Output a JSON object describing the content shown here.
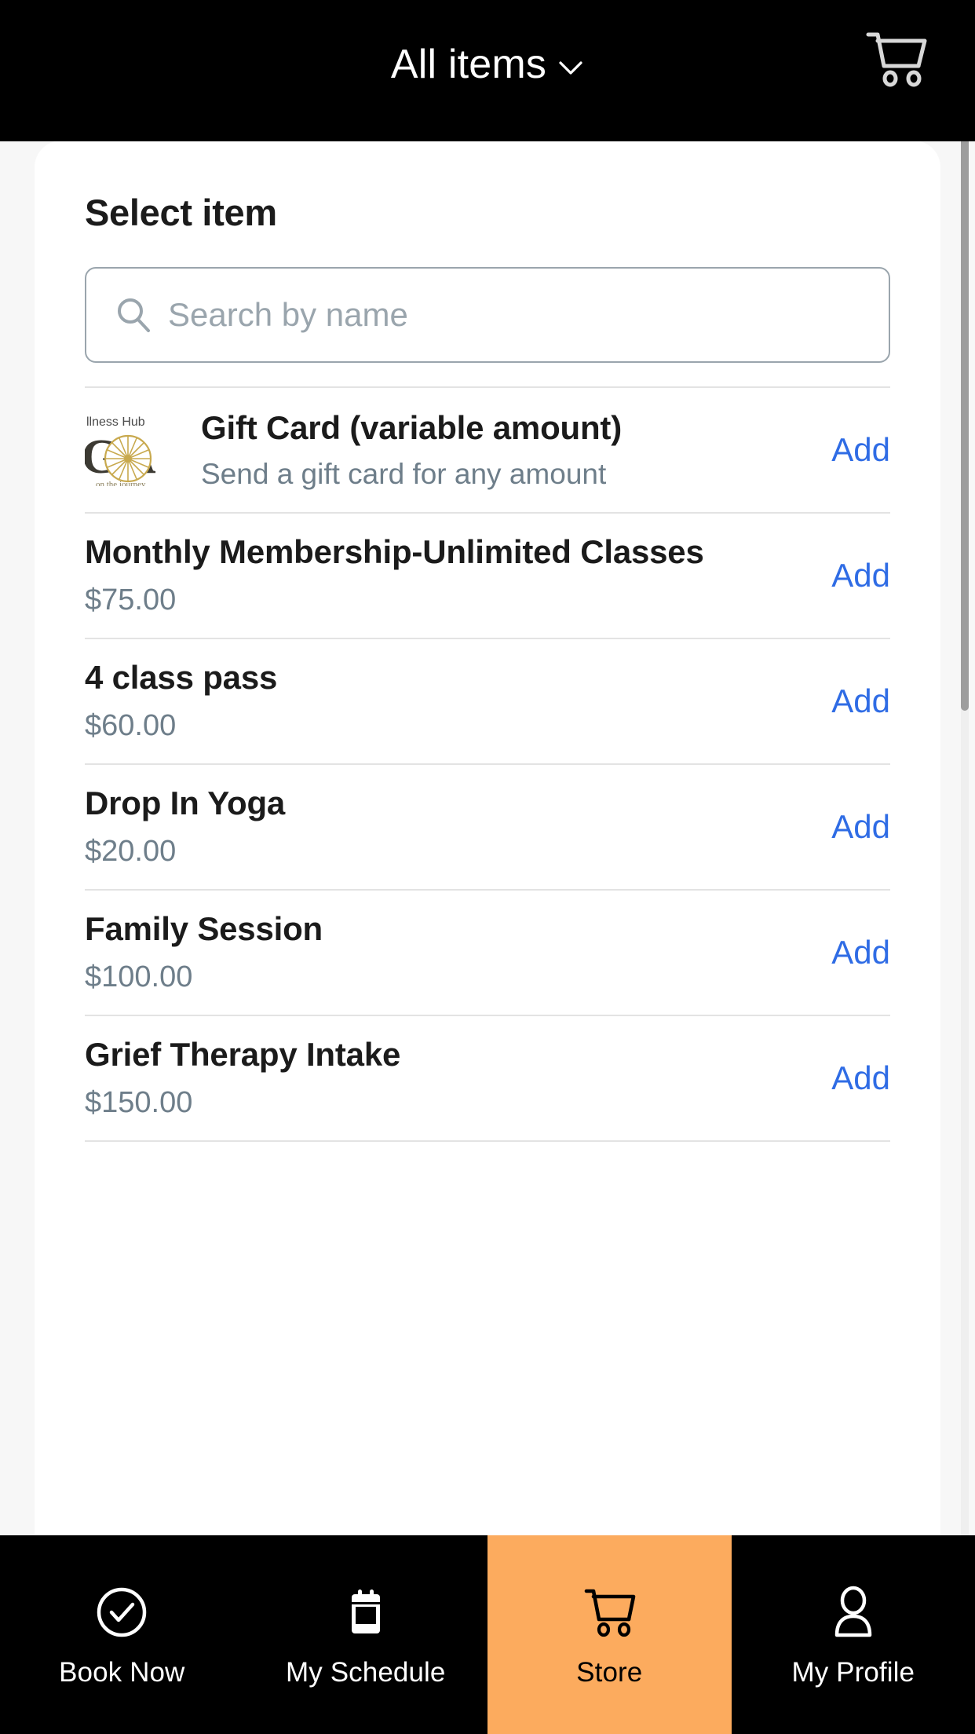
{
  "header": {
    "title": "All items",
    "chevron_icon": "chevron-down-icon",
    "cart_icon": "shopping-cart-icon"
  },
  "panel": {
    "title": "Select item"
  },
  "search": {
    "icon": "search-icon",
    "placeholder": "Search by name",
    "value": ""
  },
  "logo": {
    "top_text": "llness Hub",
    "big_letters": " GA",
    "arc_text": "on the journey"
  },
  "items": [
    {
      "name": "Gift Card (variable amount)",
      "subtitle": "Send a gift card for any amount",
      "price": "",
      "action": "Add",
      "has_thumbnail": true
    },
    {
      "name": "Monthly Membership-Unlimited Classes",
      "subtitle": "",
      "price": "$75.00",
      "action": "Add",
      "has_thumbnail": false
    },
    {
      "name": "4 class pass",
      "subtitle": "",
      "price": "$60.00",
      "action": "Add",
      "has_thumbnail": false
    },
    {
      "name": "Drop In Yoga",
      "subtitle": "",
      "price": "$20.00",
      "action": "Add",
      "has_thumbnail": false
    },
    {
      "name": "Family Session",
      "subtitle": "",
      "price": "$100.00",
      "action": "Add",
      "has_thumbnail": false
    },
    {
      "name": "Grief Therapy Intake",
      "subtitle": "",
      "price": "$150.00",
      "action": "Add",
      "has_thumbnail": false
    }
  ],
  "bottom_nav": {
    "items": [
      {
        "label": "Book Now",
        "icon": "check-circle-icon",
        "active": false
      },
      {
        "label": "My Schedule",
        "icon": "calendar-icon",
        "active": false
      },
      {
        "label": "Store",
        "icon": "shopping-cart-icon",
        "active": true
      },
      {
        "label": "My Profile",
        "icon": "person-icon",
        "active": false
      }
    ]
  },
  "colors": {
    "accent_orange": "#fcab5e",
    "link_blue": "#2f6ce5",
    "header_black": "#000000",
    "muted_text": "#6e7e8a"
  }
}
